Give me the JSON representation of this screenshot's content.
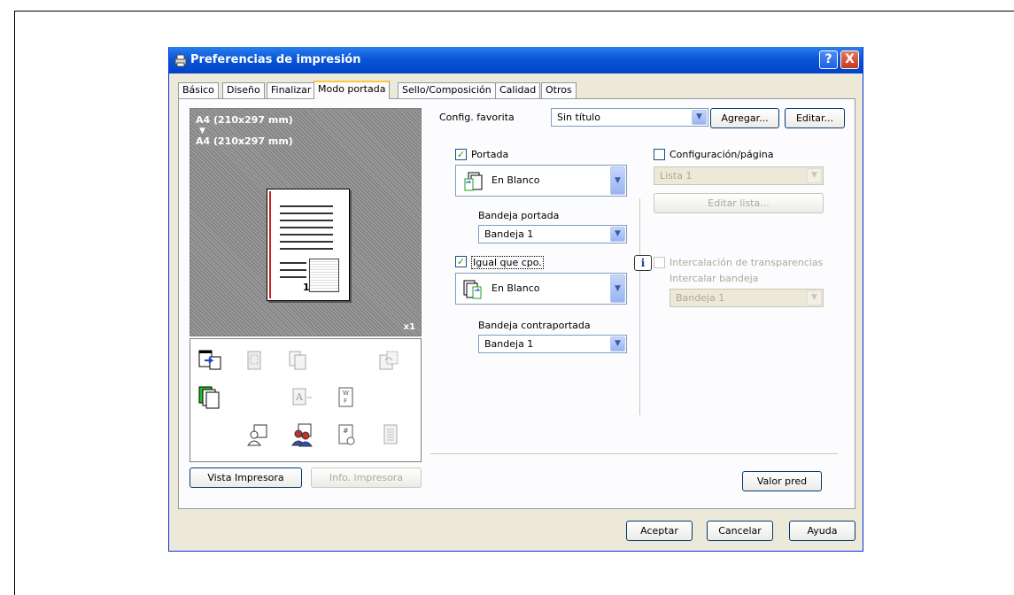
{
  "window": {
    "title": "Preferencias de impresión",
    "help_label": "?",
    "close_label": "X"
  },
  "tabs": [
    {
      "label": "Básico"
    },
    {
      "label": "Diseño"
    },
    {
      "label": "Finalizar"
    },
    {
      "label": "Modo portada",
      "active": true
    },
    {
      "label": "Sello/Composición"
    },
    {
      "label": "Calidad"
    },
    {
      "label": "Otros"
    }
  ],
  "preview": {
    "line1": "A4 (210x297 mm)",
    "arrow": "▼",
    "line2": "A4 (210x297 mm)",
    "page_number": "1",
    "copies": "x1"
  },
  "left_buttons": {
    "printer_view": "Vista Impresora",
    "printer_info": "Info. impresora"
  },
  "favorite": {
    "label": "Config. favorita",
    "value": "Sin título",
    "add": "Agregar...",
    "edit": "Editar..."
  },
  "cover": {
    "portada_label": "Portada",
    "portada_checked": true,
    "portada_value": "En Blanco",
    "bandeja_portada_label": "Bandeja portada",
    "bandeja_portada_value": "Bandeja 1",
    "igual_label": "Igual que cpo.",
    "igual_checked": true,
    "contra_value": "En Blanco",
    "bandeja_contra_label": "Bandeja contraportada",
    "bandeja_contra_value": "Bandeja 1"
  },
  "right": {
    "config_pagina_label": "Configuración/página",
    "lista_value": "Lista 1",
    "editar_lista": "Editar lista...",
    "info_icon": "i",
    "intercalacion_label": "Intercalación de transparencias",
    "intercalar_bandeja_label": "Intercalar bandeja",
    "intercalar_bandeja_value": "Bandeja 1"
  },
  "defaults_button": "Valor pred",
  "footer": {
    "accept": "Aceptar",
    "cancel": "Cancelar",
    "help": "Ayuda"
  }
}
